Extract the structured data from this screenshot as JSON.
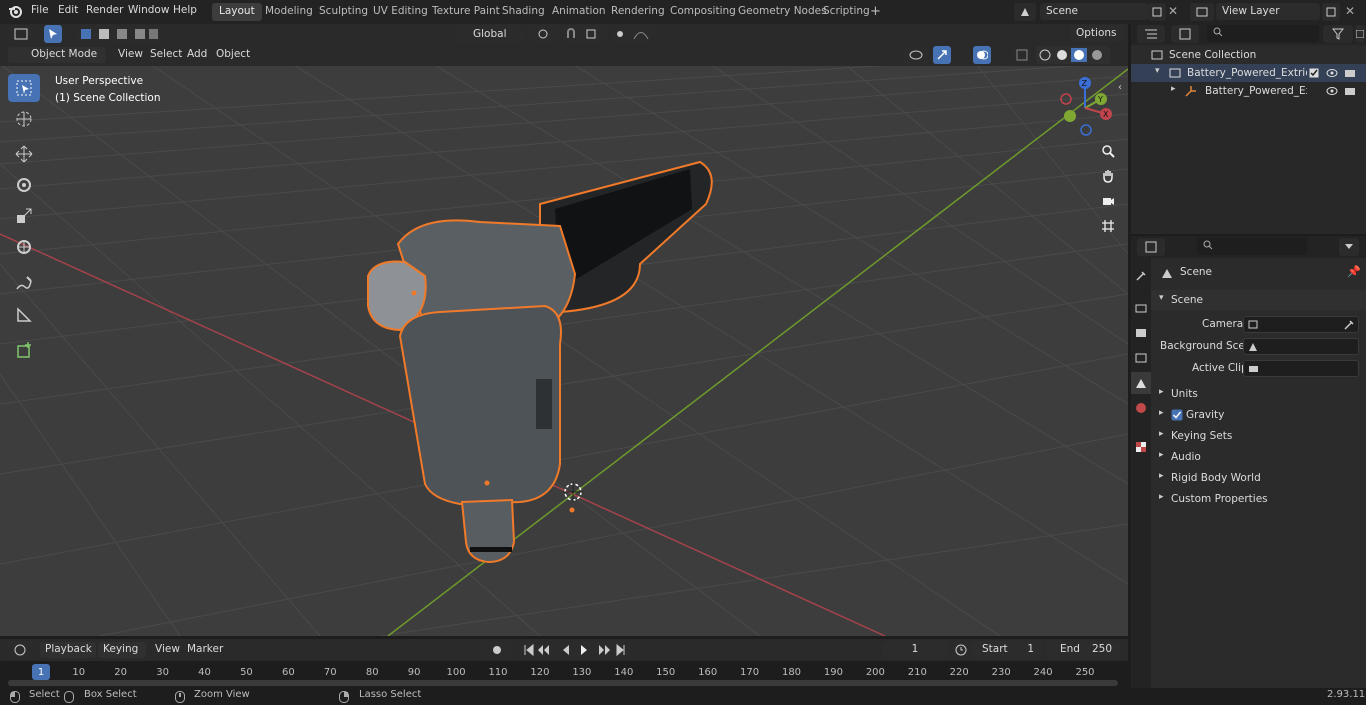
{
  "menu": {
    "file": "File",
    "edit": "Edit",
    "render": "Render",
    "window": "Window",
    "help": "Help"
  },
  "workspaces": [
    "Layout",
    "Modeling",
    "Sculpting",
    "UV Editing",
    "Texture Paint",
    "Shading",
    "Animation",
    "Rendering",
    "Compositing",
    "Geometry Nodes",
    "Scripting"
  ],
  "scene_name": "Scene",
  "view_layer": "View Layer",
  "toolbar": {
    "transform_orientation": "Global",
    "options": "Options"
  },
  "viewport": {
    "mode": "Object Mode",
    "menus": {
      "view": "View",
      "select": "Select",
      "add": "Add",
      "object": "Object"
    },
    "perspective": "User Perspective",
    "collection": "(1) Scene Collection"
  },
  "outliner": {
    "root": "Scene Collection",
    "item1": "Battery_Powered_Extrication_",
    "item2": "Battery_Powered_Extrica"
  },
  "properties": {
    "context": "Scene",
    "panel": "Scene",
    "camera_label": "Camera",
    "bg_label": "Background Scene",
    "clip_label": "Active Clip",
    "sections": [
      "Units",
      "Gravity",
      "Keying Sets",
      "Audio",
      "Rigid Body World",
      "Custom Properties"
    ]
  },
  "timeline": {
    "playback": "Playback",
    "keying": "Keying",
    "view": "View",
    "marker": "Marker",
    "current": "1",
    "start_label": "Start",
    "start": "1",
    "end_label": "End",
    "end": "250",
    "ticks": [
      "1",
      "10",
      "20",
      "30",
      "40",
      "50",
      "60",
      "70",
      "80",
      "90",
      "100",
      "110",
      "120",
      "130",
      "140",
      "150",
      "160",
      "170",
      "180",
      "190",
      "200",
      "210",
      "220",
      "230",
      "240",
      "250"
    ]
  },
  "status": {
    "select": "Select",
    "box": "Box Select",
    "zoom": "Zoom View",
    "lasso": "Lasso Select",
    "version": "2.93.11"
  },
  "colors": {
    "accent": "#4772b3",
    "selection": "#f07a2a",
    "x_axis": "#c0444c",
    "y_axis": "#7fa832"
  }
}
